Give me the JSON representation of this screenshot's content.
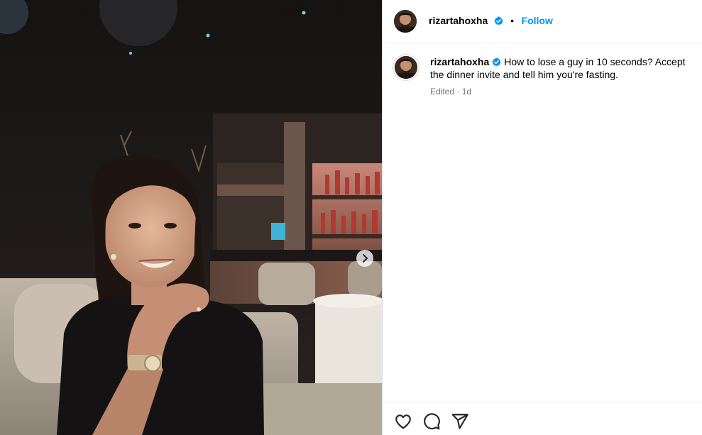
{
  "post": {
    "username": "rizartahoxha",
    "verified": true,
    "separator": "•",
    "follow_label": "Follow",
    "caption": "How to lose a guy in 10 seconds? Accept the dinner invite and tell him you're fasting.",
    "meta": "Edited · 1d"
  },
  "media": {
    "next_icon": "chevron-right-icon"
  },
  "actions": {
    "like_icon": "heart-icon",
    "comment_icon": "comment-icon",
    "share_icon": "share-icon"
  },
  "colors": {
    "accent": "#0095f6",
    "verified": "#0095f6",
    "muted": "#737373",
    "border": "#dbdbdb"
  }
}
